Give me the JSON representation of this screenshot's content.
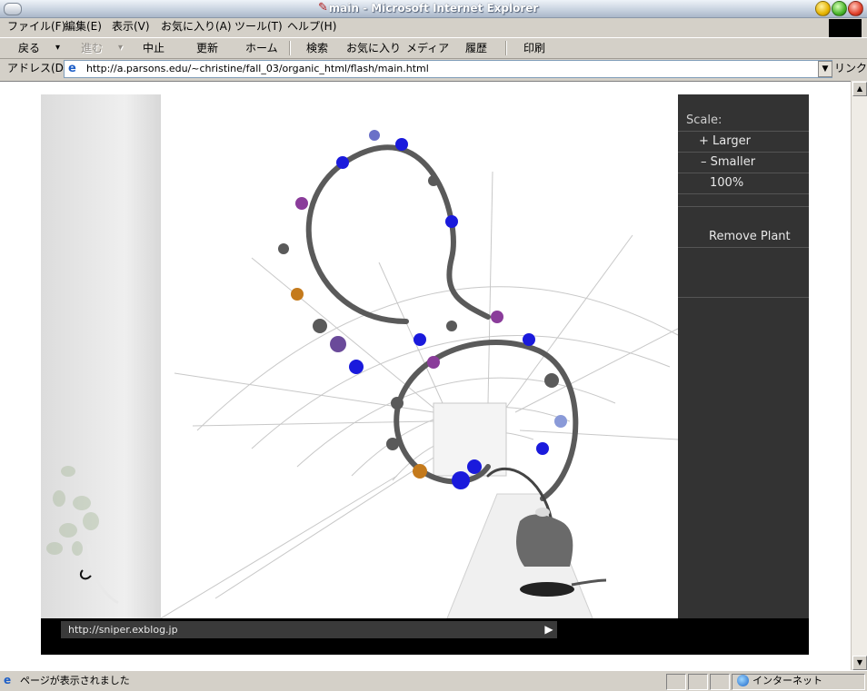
{
  "window": {
    "title": "main - Microsoft Internet Explorer"
  },
  "menu": {
    "items": [
      "ファイル(F)",
      "編集(E)",
      "表示(V)",
      "お気に入り(A)",
      "ツール(T)",
      "ヘルプ(H)"
    ]
  },
  "toolbar": {
    "back": "戻る",
    "forward": "進む",
    "stop": "中止",
    "refresh": "更新",
    "home": "ホーム",
    "search": "検索",
    "favorites": "お気に入り",
    "media": "メディア",
    "history": "履歴",
    "print": "印刷",
    "dropdown_arrow": "▾"
  },
  "address_bar": {
    "label": "アドレス(D)",
    "url": "http://a.parsons.edu/~christine/fall_03/organic_html/flash/main.html",
    "links_label": "リンク"
  },
  "flash": {
    "scale_label": "Scale:",
    "larger_label": "+ Larger",
    "smaller_label": "– Smaller",
    "scale_value": "100%",
    "remove_plant_label": "Remove Plant",
    "footer_url": "http://sniper.exblog.jp",
    "play_glyph": "▶"
  },
  "status_bar": {
    "text": "ページが表示されました",
    "zone": "インターネット"
  },
  "colors": {
    "chrome": "#d4d0c8",
    "panel_dark": "#333333",
    "plant_blue": "#1a1adc",
    "plant_purple": "#8a3c9a",
    "plant_gray": "#5a5a5a",
    "plant_orange": "#c47a1c"
  }
}
